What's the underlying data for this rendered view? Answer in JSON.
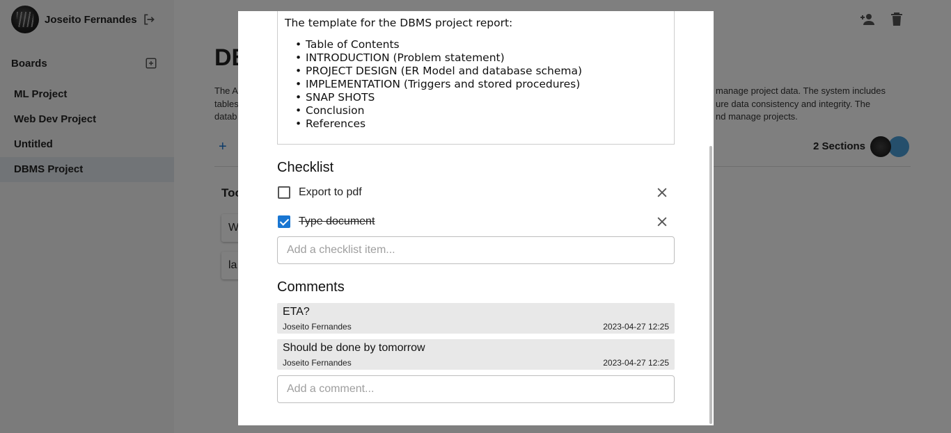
{
  "sidebar": {
    "user_name": "Joseito Fernandes",
    "boards_title": "Boards",
    "items": [
      {
        "label": "ML Project"
      },
      {
        "label": "Web Dev Project"
      },
      {
        "label": "Untitled"
      },
      {
        "label": "DBMS Project"
      }
    ]
  },
  "main": {
    "board_title": "DB",
    "description_left": [
      "The A",
      "tables",
      "datab"
    ],
    "description_right": [
      "manage project data. The system includes",
      "ure data consistency and integrity. The",
      "nd manage projects."
    ],
    "add_section_icon": "+",
    "sections_count": "2 Sections",
    "column_title": "Too",
    "cards": [
      {
        "text": "W"
      },
      {
        "text": "la"
      }
    ]
  },
  "modal": {
    "description": {
      "intro": "The template for the DBMS project report:",
      "items": [
        "Table of Contents",
        "INTRODUCTION (Problem statement)",
        "PROJECT DESIGN (ER Model and database schema)",
        "IMPLEMENTATION (Triggers and stored procedures)",
        "SNAP SHOTS",
        "Conclusion",
        "References"
      ]
    },
    "checklist": {
      "title": "Checklist",
      "items": [
        {
          "label": "Export to pdf",
          "checked": false
        },
        {
          "label": "Type document",
          "checked": true
        }
      ],
      "input_placeholder": "Add a checklist item..."
    },
    "comments": {
      "title": "Comments",
      "items": [
        {
          "text": "ETA?",
          "author": "Joseito Fernandes",
          "time": "2023-04-27 12:25"
        },
        {
          "text": "Should be done by tomorrow",
          "author": "Joseito Fernandes",
          "time": "2023-04-27 12:25"
        }
      ],
      "input_placeholder": "Add a comment..."
    }
  },
  "icons": [
    "logout-icon",
    "add-board-icon",
    "add-person-icon",
    "delete-icon",
    "close-icon",
    "checkbox-icon"
  ],
  "colors": {
    "accent": "#1976d2",
    "backdrop": "rgba(0,0,0,0.5)",
    "comment_bg": "#e8e8e8"
  }
}
